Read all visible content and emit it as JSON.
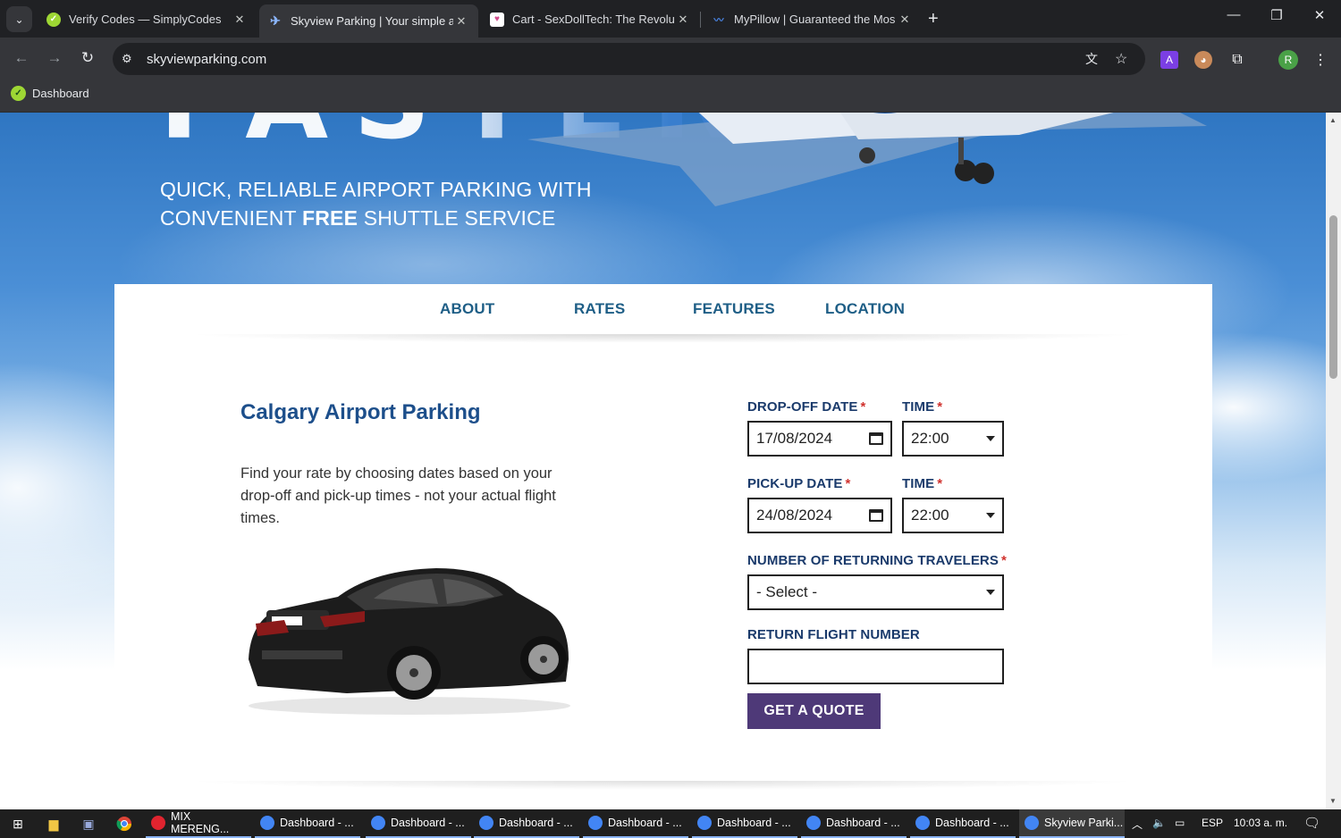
{
  "browser": {
    "tabs": [
      {
        "title": "Verify Codes — SimplyCodes",
        "active": false,
        "favicon_color": "#9ed734"
      },
      {
        "title": "Skyview Parking | Your simple a",
        "active": true,
        "favicon_color": "#2a6fd1"
      },
      {
        "title": "Cart - SexDollTech: The Revoluti",
        "active": false,
        "favicon_color": "#d24b8d"
      },
      {
        "title": "MyPillow | Guaranteed the Mos",
        "active": false,
        "favicon_color": "#1c4f9c"
      }
    ],
    "url": "skyviewparking.com",
    "bookmarks": [
      {
        "label": "Dashboard"
      }
    ],
    "profile_initial": "R",
    "extension_a": "A"
  },
  "hero": {
    "word": "FASTER",
    "tagline_line1": "QUICK, RELIABLE AIRPORT PARKING WITH",
    "tagline_line2_pre": "CONVENIENT ",
    "tagline_line2_bold": "FREE",
    "tagline_line2_post": " SHUTTLE SERVICE"
  },
  "nav": {
    "items": [
      {
        "label": "ABOUT"
      },
      {
        "label": "RATES"
      },
      {
        "label": "FEATURES"
      },
      {
        "label": "LOCATION"
      }
    ]
  },
  "main": {
    "title": "Calgary Airport Parking",
    "intro": "Find your rate by choosing dates based on your drop-off and pick-up times - not your actual flight times."
  },
  "form": {
    "dropoff_date_label": "DROP-OFF DATE",
    "dropoff_date_value": "17/08/2024",
    "dropoff_time_label": "TIME",
    "dropoff_time_value": "22:00",
    "pickup_date_label": "PICK-UP DATE",
    "pickup_date_value": "24/08/2024",
    "pickup_time_label": "TIME",
    "pickup_time_value": "22:00",
    "travelers_label": "NUMBER OF RETURNING TRAVELERS",
    "travelers_value": "- Select -",
    "flight_label": "RETURN FLIGHT NUMBER",
    "flight_value": "",
    "required_mark": "*",
    "submit_label": "GET A QUOTE"
  },
  "taskbar": {
    "apps": [
      {
        "label": "MIX MERENG...",
        "active": false,
        "color": "#e0242f"
      },
      {
        "label": "Dashboard - ...",
        "active": false,
        "color": "#4285f4"
      },
      {
        "label": "Dashboard - ...",
        "active": false,
        "color": "#4285f4"
      },
      {
        "label": "Dashboard - ...",
        "active": false,
        "color": "#4285f4"
      },
      {
        "label": "Dashboard - ...",
        "active": false,
        "color": "#4285f4"
      },
      {
        "label": "Dashboard - ...",
        "active": false,
        "color": "#4285f4"
      },
      {
        "label": "Dashboard - ...",
        "active": false,
        "color": "#4285f4"
      },
      {
        "label": "Dashboard - ...",
        "active": false,
        "color": "#4285f4"
      },
      {
        "label": "Skyview Parki...",
        "active": true,
        "color": "#4285f4"
      }
    ],
    "language": "ESP",
    "clock": "10:03 a. m."
  },
  "colors": {
    "brand_blue": "#1d4f8b",
    "nav_blue": "#1e5e86",
    "button_purple": "#4e3978",
    "required_red": "#d0312d"
  }
}
